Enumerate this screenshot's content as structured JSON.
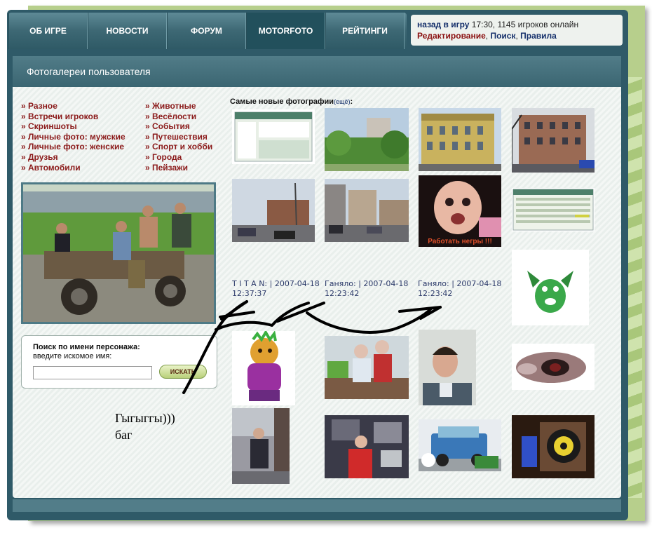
{
  "nav": {
    "items": [
      {
        "label": "ОБ ИГРЕ"
      },
      {
        "label": "НОВОСТИ"
      },
      {
        "label": "ФОРУМ"
      },
      {
        "label": "MOTORFOTO"
      },
      {
        "label": "РЕЙТИНГИ"
      }
    ],
    "active_index": 3
  },
  "top_info": {
    "back_link": "назад в игру",
    "status": "17:30, 1145 игроков онлайн",
    "edit_link": "Редактирование",
    "search_link": "Поиск",
    "rules_link": "Правила"
  },
  "page_title": "Фотогалереи пользователя",
  "categories_left": [
    "» Разное",
    "» Встречи игроков",
    "» Скриншоты",
    "» Личные фото: мужские",
    "» Личные фото: женские",
    "» Друзья",
    "» Автомобили"
  ],
  "categories_right": [
    "» Животные",
    "» Весёлости",
    "» События",
    "» Путешествия",
    "» Спорт и хобби",
    "» Города",
    "» Пейзажи"
  ],
  "search": {
    "title": "Поиск по имени персонажа:",
    "subtitle": "введите искомое имя:",
    "input_value": "",
    "button_label": "ИСКАТЬ"
  },
  "newest": {
    "title": "Самые новые фотографии",
    "more_label": "(ещё)",
    "colon": ":"
  },
  "thumb_overlay_text": "Работать негры !!!",
  "captions": [
    {
      "line1": "T I T A N: | 2007-04-18",
      "line2": "12:37:37"
    },
    {
      "line1": "Ганяло: | 2007-04-18",
      "line2": "12:23:42"
    },
    {
      "line1": "Ганяло: | 2007-04-18",
      "line2": "12:23:42"
    }
  ],
  "annotation": {
    "line1": "Гыгыггы)))",
    "line2": "баг"
  },
  "colors": {
    "frame": "#2f5a68",
    "category_link": "#8b1a1a",
    "caption_text": "#2c3a6a",
    "link_blue": "#15306b"
  }
}
